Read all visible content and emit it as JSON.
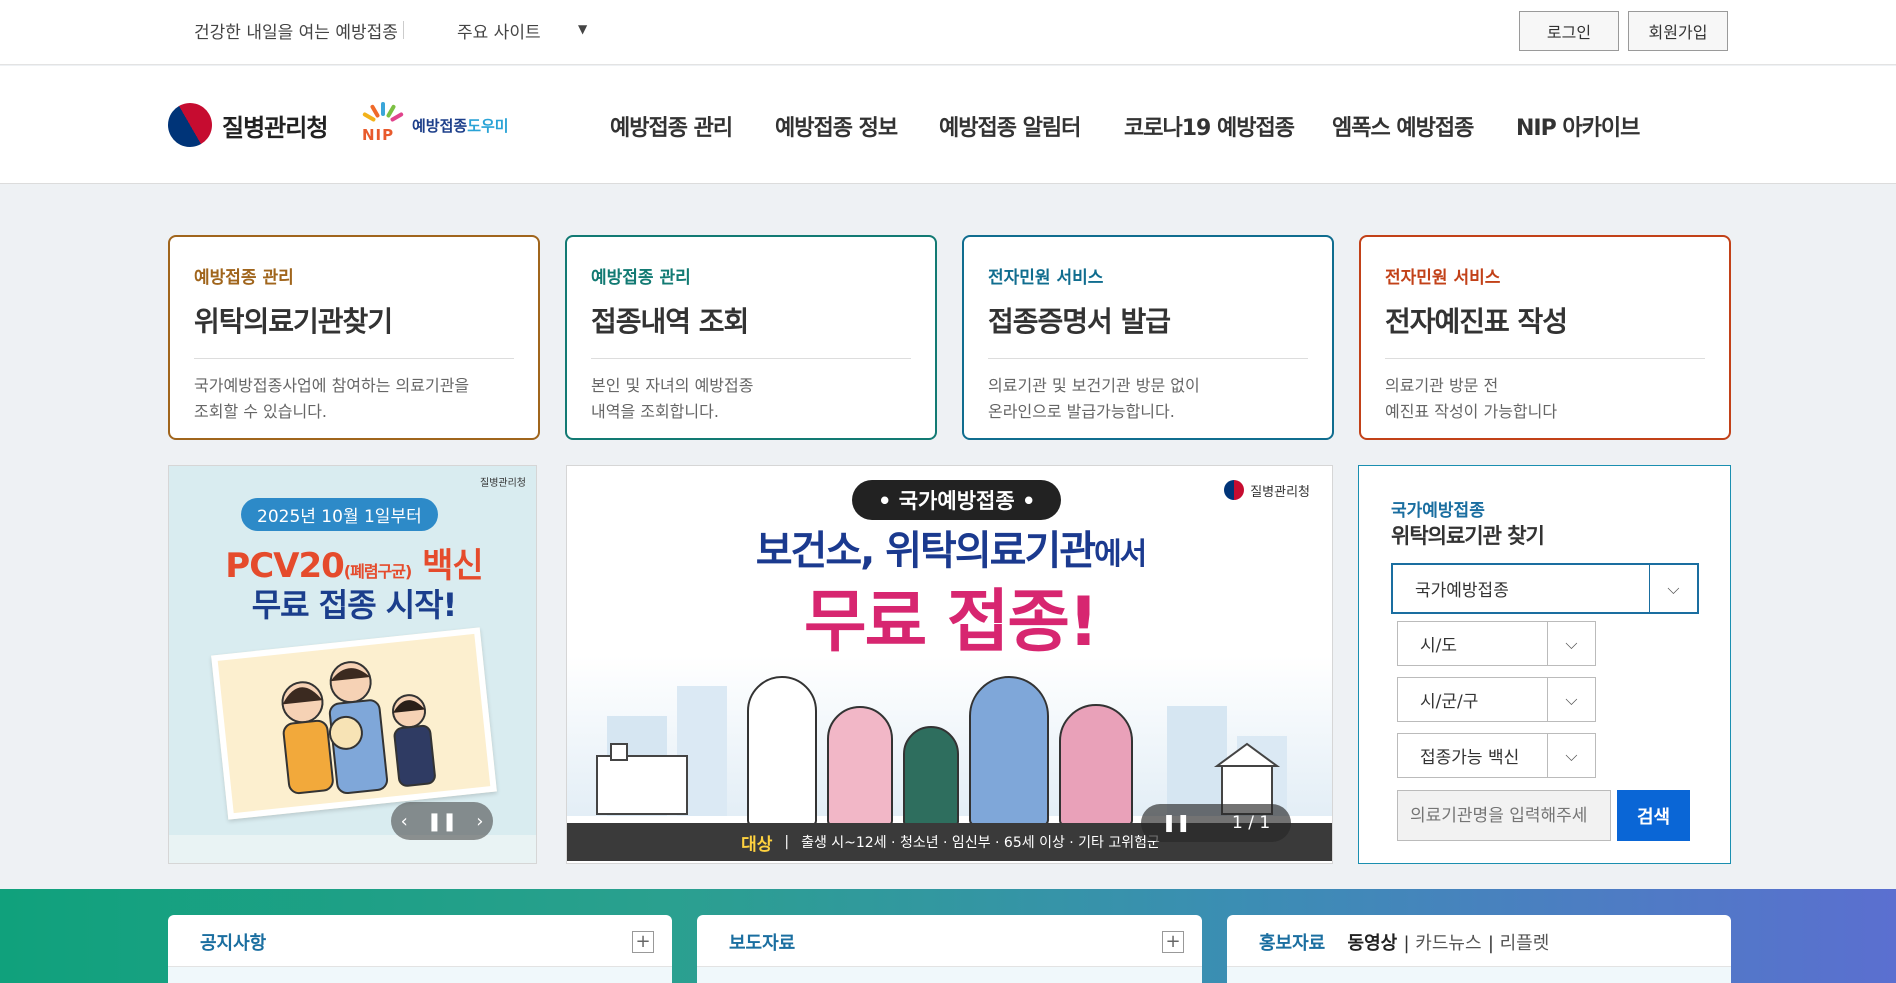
{
  "topbar": {
    "slogan": "건강한 내일을 여는 예방접종",
    "sites": "주요 사이트",
    "login": "로그인",
    "join": "회원가입"
  },
  "header": {
    "kdca_name": "질병관리청",
    "nip_logo_label_a": "예방접종",
    "nip_logo_label_b": "도우미",
    "nip_mark": "NIP",
    "nav": [
      "예방접종 관리",
      "예방접종 정보",
      "예방접종 알림터",
      "코로나19 예방접종",
      "엠폭스 예방접종",
      "NIP 아카이브"
    ]
  },
  "cards": [
    {
      "category": "예방접종 관리",
      "title": "위탁의료기관찾기",
      "desc1": "국가예방접종사업에 참여하는 의료기관을",
      "desc2": "조회할 수 있습니다.",
      "color": "#a0651c"
    },
    {
      "category": "예방접종 관리",
      "title": "접종내역 조회",
      "desc1": "본인 및 자녀의 예방접종",
      "desc2": "내역을 조회합니다.",
      "color": "#127a73"
    },
    {
      "category": "전자민원 서비스",
      "title": "접종증명서 발급",
      "desc1": "의료기관 및 보건기관 방문 없이",
      "desc2": "온라인으로 발급가능합니다.",
      "color": "#106d8f"
    },
    {
      "category": "전자민원 서비스",
      "title": "전자예진표 작성",
      "desc1": "의료기관 방문 전",
      "desc2": "예진표 작성이 가능합니다",
      "color": "#c24118"
    }
  ],
  "banner1": {
    "kdca": "질병관리청",
    "date": "2025년 10월 1일부터",
    "headline_a": "PCV20",
    "headline_small": "(폐렴구균)",
    "headline_b": " 백신",
    "headline2": "무료 접종 시작!"
  },
  "banner2": {
    "pill": "• 국가예방접종 •",
    "kdca": "질병관리청",
    "headline_a": "보건소, 위탁의료기관",
    "headline_small": "에서",
    "headline2": "무료 접종!",
    "target_label": "대상",
    "target_text": "출생 시~12세 · 청소년 · 임신부 · 65세 이상 · 기타 고위험군",
    "counter": "1 / 1"
  },
  "search_panel": {
    "category": "국가예방접종",
    "title": "위탁의료기관 찾기",
    "main_select": "국가예방접종",
    "sido": "시/도",
    "sigungu": "시/군/구",
    "vaccine": "접종가능 백신",
    "input_placeholder": "의료기관명을 입력해주세",
    "search": "검색"
  },
  "boards": {
    "notice": "공지사항",
    "press": "보도자료",
    "promo": "홍보자료",
    "promo_tabs": [
      "동영상",
      "카드뉴스",
      "리플렛"
    ]
  }
}
